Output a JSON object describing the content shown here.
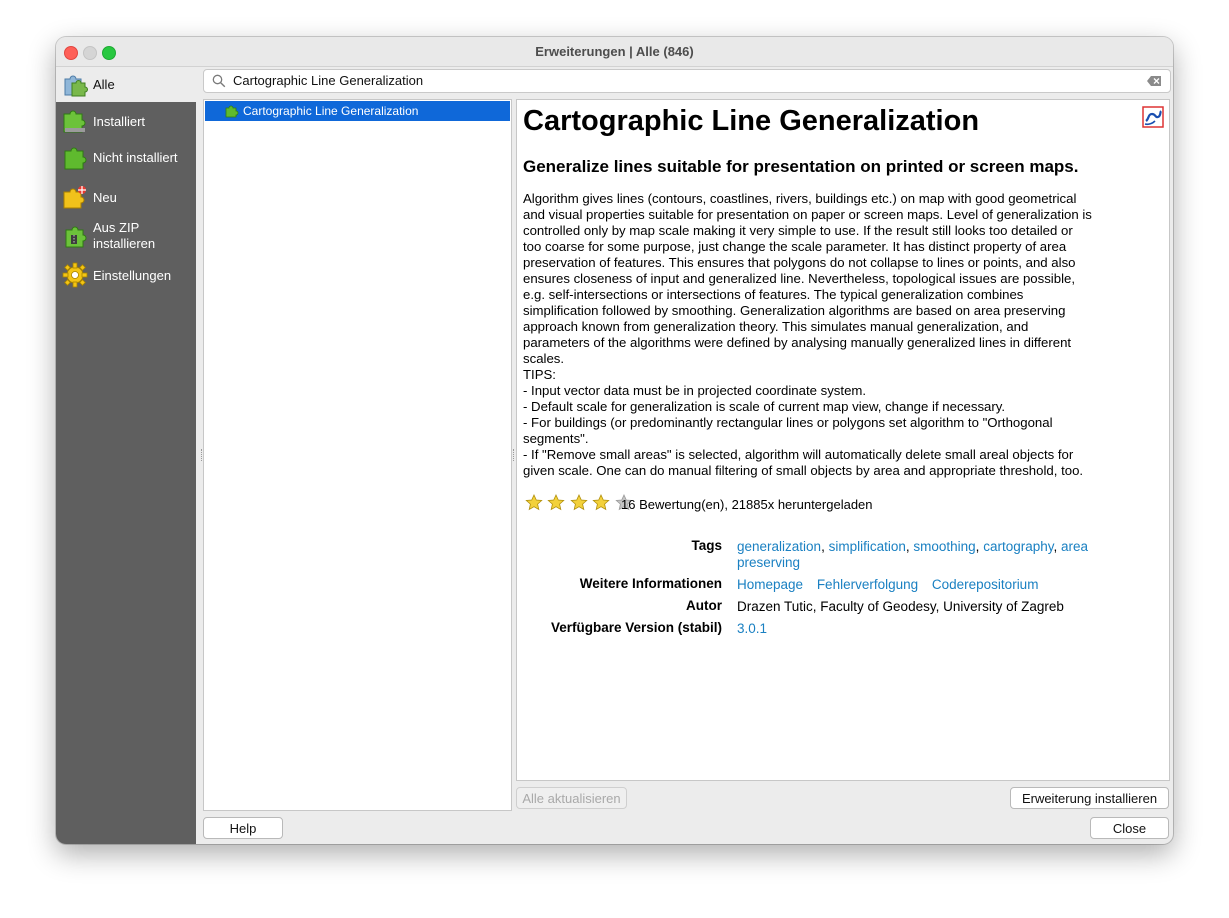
{
  "window": {
    "title": "Erweiterungen | Alle (846)"
  },
  "sidebar": {
    "items": [
      {
        "label": "Alle",
        "icon": "puzzle-all-icon",
        "active": true
      },
      {
        "label": "Installiert",
        "icon": "puzzle-installed-icon"
      },
      {
        "label": "Nicht installiert",
        "icon": "puzzle-not-installed-icon"
      },
      {
        "label": "Neu",
        "icon": "puzzle-new-icon"
      },
      {
        "label": "Aus ZIP",
        "label2": "installieren",
        "icon": "puzzle-zip-icon"
      },
      {
        "label": "Einstellungen",
        "icon": "gear-icon"
      }
    ]
  },
  "search": {
    "value": "Cartographic Line Generalization"
  },
  "plugin_list": [
    {
      "label": "Cartographic Line Generalization",
      "selected": true
    }
  ],
  "details": {
    "title": "Cartographic Line Generalization",
    "subtitle": "Generalize lines suitable for presentation on printed or screen maps.",
    "description_lines": [
      "Algorithm gives lines (contours, coastlines, rivers, buildings etc.) on map with good geometrical",
      "and visual properties suitable for presentation on paper or screen maps. Level of generalization is",
      "controlled only by map scale making it very simple to use. If the result still looks too detailed or",
      "too coarse for some purpose, just change the scale parameter. It has distinct property of area",
      "preservation of features. This ensures that polygons do not collapse to lines or points, and also",
      "ensures closeness of input and generalized line. Nevertheless, topological issues are possible,",
      "e.g. self-intersections or intersections of features. The typical generalization combines",
      "simplification followed by smoothing. Generalization algorithms are based on area preserving",
      "approach known from generalization theory. This simulates manual generalization, and",
      "parameters of the algorithms were defined by analysing manually generalized lines in different",
      "scales.",
      "TIPS:",
      "- Input vector data must be in projected coordinate system.",
      "- Default scale for generalization is scale of current map view, change if necessary.",
      "- For buildings (or predominantly rectangular lines or polygons set algorithm to \"Orthogonal",
      "segments\".",
      "- If \"Remove small areas\" is selected, algorithm will automatically delete small areal objects for",
      "given scale. One can do manual filtering of small objects by area and appropriate threshold, too."
    ],
    "rating": {
      "stars": 4,
      "max": 5,
      "text": "16 Bewertung(en), 21885x heruntergeladen"
    },
    "tags_label": "Tags",
    "tags": [
      "generalization",
      "simplification",
      "smoothing",
      "cartography",
      "area",
      "preserving"
    ],
    "more_info_label": "Weitere Informationen",
    "more_info_links": [
      "Homepage",
      "Fehlerverfolgung",
      "Coderepositorium"
    ],
    "author_label": "Autor",
    "author": "Drazen Tutic, Faculty of Geodesy, University of Zagreb",
    "version_label": "Verfügbare Version (stabil)",
    "version": "3.0.1"
  },
  "buttons": {
    "upgrade_all": "Alle aktualisieren",
    "install": "Erweiterung installieren",
    "help": "Help",
    "close": "Close"
  },
  "colors": {
    "link": "#1a80c2",
    "selection": "#0f68d9",
    "sidebar": "#5f5f5f"
  }
}
